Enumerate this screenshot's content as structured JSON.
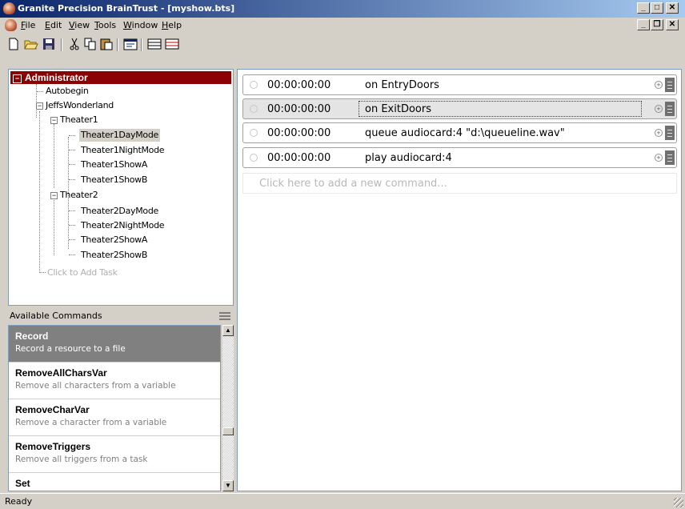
{
  "window": {
    "title": "Granite Precision BrainTrust - [myshow.bts]"
  },
  "menu": [
    "File",
    "Edit",
    "View",
    "Tools",
    "Window",
    "Help"
  ],
  "tree": {
    "root": "Administrator",
    "autobegin": "Autobegin",
    "project": "JeffsWonderland",
    "theater1": "Theater1",
    "t1_items": [
      "Theater1DayMode",
      "Theater1NightMode",
      "Theater1ShowA",
      "Theater1ShowB"
    ],
    "theater2": "Theater2",
    "t2_items": [
      "Theater2DayMode",
      "Theater2NightMode",
      "Theater2ShowA",
      "Theater2ShowB"
    ],
    "add_task": "Click to Add Task"
  },
  "commands_panel": {
    "title": "Available Commands",
    "items": [
      {
        "name": "Record",
        "desc": "Record a resource to a file"
      },
      {
        "name": "RemoveAllCharsVar",
        "desc": "Remove all characters from a variable"
      },
      {
        "name": "RemoveCharVar",
        "desc": "Remove a character from a variable"
      },
      {
        "name": "RemoveTriggers",
        "desc": "Remove all triggers from a task"
      },
      {
        "name": "Set",
        "desc": ""
      }
    ]
  },
  "script_rows": [
    {
      "time": "00:00:00:00",
      "command": "on EntryDoors"
    },
    {
      "time": "00:00:00:00",
      "command": "on ExitDoors"
    },
    {
      "time": "00:00:00:00",
      "command": "queue audiocard:4 \"d:\\queueline.wav\""
    },
    {
      "time": "00:00:00:00",
      "command": "play audiocard:4"
    }
  ],
  "add_command": "Click here to add a new command...",
  "status": "Ready",
  "colors": {
    "title_start": "#0a246a",
    "title_end": "#a6caf0",
    "root_bg": "#8b0000",
    "selected_command_bg": "#808080"
  }
}
